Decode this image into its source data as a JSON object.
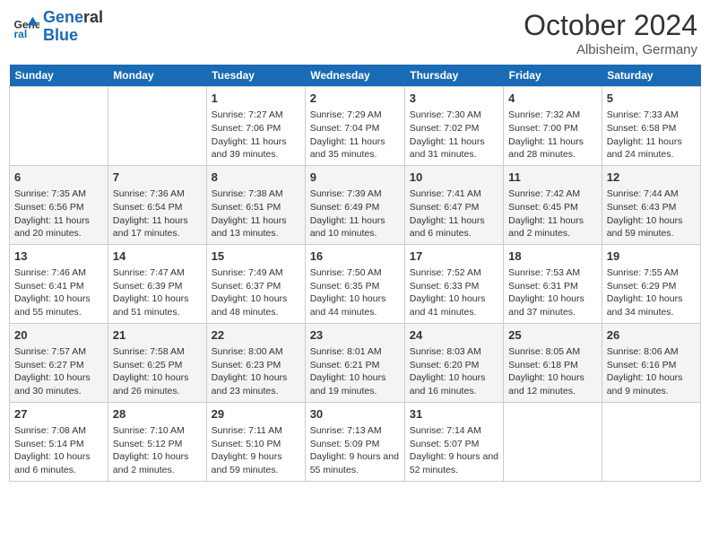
{
  "header": {
    "logo_line1": "General",
    "logo_line2": "Blue",
    "month": "October 2024",
    "location": "Albisheim, Germany"
  },
  "weekdays": [
    "Sunday",
    "Monday",
    "Tuesday",
    "Wednesday",
    "Thursday",
    "Friday",
    "Saturday"
  ],
  "weeks": [
    [
      {
        "day": "",
        "sunrise": "",
        "sunset": "",
        "daylight": ""
      },
      {
        "day": "",
        "sunrise": "",
        "sunset": "",
        "daylight": ""
      },
      {
        "day": "1",
        "sunrise": "Sunrise: 7:27 AM",
        "sunset": "Sunset: 7:06 PM",
        "daylight": "Daylight: 11 hours and 39 minutes."
      },
      {
        "day": "2",
        "sunrise": "Sunrise: 7:29 AM",
        "sunset": "Sunset: 7:04 PM",
        "daylight": "Daylight: 11 hours and 35 minutes."
      },
      {
        "day": "3",
        "sunrise": "Sunrise: 7:30 AM",
        "sunset": "Sunset: 7:02 PM",
        "daylight": "Daylight: 11 hours and 31 minutes."
      },
      {
        "day": "4",
        "sunrise": "Sunrise: 7:32 AM",
        "sunset": "Sunset: 7:00 PM",
        "daylight": "Daylight: 11 hours and 28 minutes."
      },
      {
        "day": "5",
        "sunrise": "Sunrise: 7:33 AM",
        "sunset": "Sunset: 6:58 PM",
        "daylight": "Daylight: 11 hours and 24 minutes."
      }
    ],
    [
      {
        "day": "6",
        "sunrise": "Sunrise: 7:35 AM",
        "sunset": "Sunset: 6:56 PM",
        "daylight": "Daylight: 11 hours and 20 minutes."
      },
      {
        "day": "7",
        "sunrise": "Sunrise: 7:36 AM",
        "sunset": "Sunset: 6:54 PM",
        "daylight": "Daylight: 11 hours and 17 minutes."
      },
      {
        "day": "8",
        "sunrise": "Sunrise: 7:38 AM",
        "sunset": "Sunset: 6:51 PM",
        "daylight": "Daylight: 11 hours and 13 minutes."
      },
      {
        "day": "9",
        "sunrise": "Sunrise: 7:39 AM",
        "sunset": "Sunset: 6:49 PM",
        "daylight": "Daylight: 11 hours and 10 minutes."
      },
      {
        "day": "10",
        "sunrise": "Sunrise: 7:41 AM",
        "sunset": "Sunset: 6:47 PM",
        "daylight": "Daylight: 11 hours and 6 minutes."
      },
      {
        "day": "11",
        "sunrise": "Sunrise: 7:42 AM",
        "sunset": "Sunset: 6:45 PM",
        "daylight": "Daylight: 11 hours and 2 minutes."
      },
      {
        "day": "12",
        "sunrise": "Sunrise: 7:44 AM",
        "sunset": "Sunset: 6:43 PM",
        "daylight": "Daylight: 10 hours and 59 minutes."
      }
    ],
    [
      {
        "day": "13",
        "sunrise": "Sunrise: 7:46 AM",
        "sunset": "Sunset: 6:41 PM",
        "daylight": "Daylight: 10 hours and 55 minutes."
      },
      {
        "day": "14",
        "sunrise": "Sunrise: 7:47 AM",
        "sunset": "Sunset: 6:39 PM",
        "daylight": "Daylight: 10 hours and 51 minutes."
      },
      {
        "day": "15",
        "sunrise": "Sunrise: 7:49 AM",
        "sunset": "Sunset: 6:37 PM",
        "daylight": "Daylight: 10 hours and 48 minutes."
      },
      {
        "day": "16",
        "sunrise": "Sunrise: 7:50 AM",
        "sunset": "Sunset: 6:35 PM",
        "daylight": "Daylight: 10 hours and 44 minutes."
      },
      {
        "day": "17",
        "sunrise": "Sunrise: 7:52 AM",
        "sunset": "Sunset: 6:33 PM",
        "daylight": "Daylight: 10 hours and 41 minutes."
      },
      {
        "day": "18",
        "sunrise": "Sunrise: 7:53 AM",
        "sunset": "Sunset: 6:31 PM",
        "daylight": "Daylight: 10 hours and 37 minutes."
      },
      {
        "day": "19",
        "sunrise": "Sunrise: 7:55 AM",
        "sunset": "Sunset: 6:29 PM",
        "daylight": "Daylight: 10 hours and 34 minutes."
      }
    ],
    [
      {
        "day": "20",
        "sunrise": "Sunrise: 7:57 AM",
        "sunset": "Sunset: 6:27 PM",
        "daylight": "Daylight: 10 hours and 30 minutes."
      },
      {
        "day": "21",
        "sunrise": "Sunrise: 7:58 AM",
        "sunset": "Sunset: 6:25 PM",
        "daylight": "Daylight: 10 hours and 26 minutes."
      },
      {
        "day": "22",
        "sunrise": "Sunrise: 8:00 AM",
        "sunset": "Sunset: 6:23 PM",
        "daylight": "Daylight: 10 hours and 23 minutes."
      },
      {
        "day": "23",
        "sunrise": "Sunrise: 8:01 AM",
        "sunset": "Sunset: 6:21 PM",
        "daylight": "Daylight: 10 hours and 19 minutes."
      },
      {
        "day": "24",
        "sunrise": "Sunrise: 8:03 AM",
        "sunset": "Sunset: 6:20 PM",
        "daylight": "Daylight: 10 hours and 16 minutes."
      },
      {
        "day": "25",
        "sunrise": "Sunrise: 8:05 AM",
        "sunset": "Sunset: 6:18 PM",
        "daylight": "Daylight: 10 hours and 12 minutes."
      },
      {
        "day": "26",
        "sunrise": "Sunrise: 8:06 AM",
        "sunset": "Sunset: 6:16 PM",
        "daylight": "Daylight: 10 hours and 9 minutes."
      }
    ],
    [
      {
        "day": "27",
        "sunrise": "Sunrise: 7:08 AM",
        "sunset": "Sunset: 5:14 PM",
        "daylight": "Daylight: 10 hours and 6 minutes."
      },
      {
        "day": "28",
        "sunrise": "Sunrise: 7:10 AM",
        "sunset": "Sunset: 5:12 PM",
        "daylight": "Daylight: 10 hours and 2 minutes."
      },
      {
        "day": "29",
        "sunrise": "Sunrise: 7:11 AM",
        "sunset": "Sunset: 5:10 PM",
        "daylight": "Daylight: 9 hours and 59 minutes."
      },
      {
        "day": "30",
        "sunrise": "Sunrise: 7:13 AM",
        "sunset": "Sunset: 5:09 PM",
        "daylight": "Daylight: 9 hours and 55 minutes."
      },
      {
        "day": "31",
        "sunrise": "Sunrise: 7:14 AM",
        "sunset": "Sunset: 5:07 PM",
        "daylight": "Daylight: 9 hours and 52 minutes."
      },
      {
        "day": "",
        "sunrise": "",
        "sunset": "",
        "daylight": ""
      },
      {
        "day": "",
        "sunrise": "",
        "sunset": "",
        "daylight": ""
      }
    ]
  ]
}
